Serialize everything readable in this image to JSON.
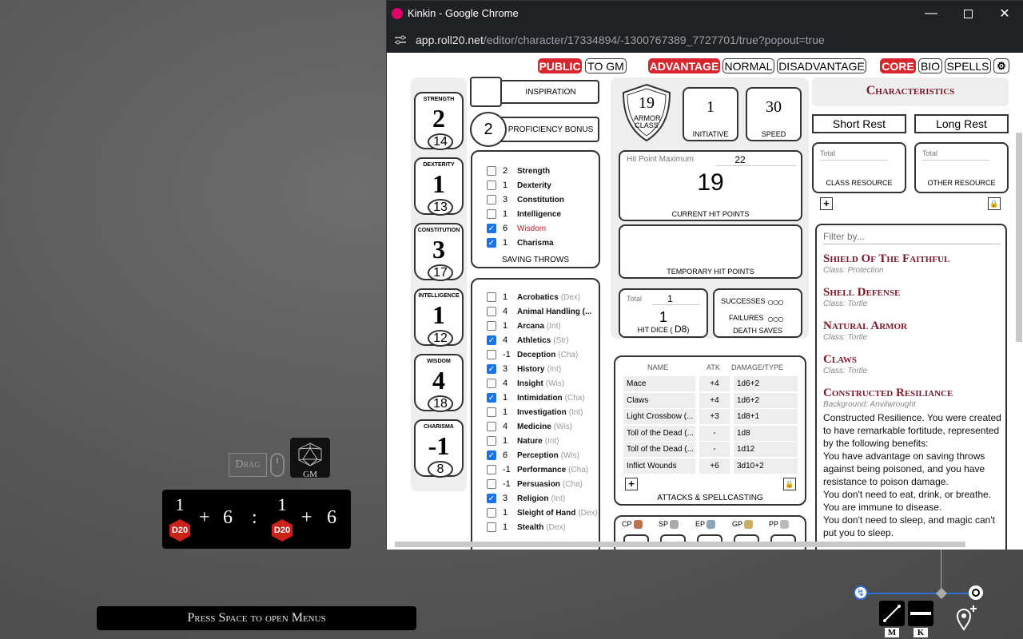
{
  "window": {
    "title": "Kinkin - Google Chrome",
    "url_host": "app.roll20.net",
    "url_path": "/editor/character/17334894/-1300767389_7727701/true?popout=true"
  },
  "toggles": {
    "public": "PUBLIC",
    "to_gm": "TO GM",
    "advantage": "ADVANTAGE",
    "normal": "NORMAL",
    "disadvantage": "DISADVANTAGE",
    "core": "CORE",
    "bio": "BIO",
    "spells": "SPELLS"
  },
  "abilities": [
    {
      "name": "STRENGTH",
      "mod": "2",
      "score": "14"
    },
    {
      "name": "DEXTERITY",
      "mod": "1",
      "score": "13"
    },
    {
      "name": "CONSTITUTION",
      "mod": "3",
      "score": "17"
    },
    {
      "name": "INTELLIGENCE",
      "mod": "1",
      "score": "12"
    },
    {
      "name": "WISDOM",
      "mod": "4",
      "score": "18"
    },
    {
      "name": "CHARISMA",
      "mod": "-1",
      "score": "8"
    }
  ],
  "inspiration": {
    "label": "INSPIRATION"
  },
  "proficiency": {
    "value": "2",
    "label": "PROFICIENCY BONUS"
  },
  "saving_throws": {
    "label": "SAVING THROWS",
    "items": [
      {
        "value": "2",
        "name": "Strength",
        "checked": false
      },
      {
        "value": "1",
        "name": "Dexterity",
        "checked": false
      },
      {
        "value": "3",
        "name": "Constitution",
        "checked": false
      },
      {
        "value": "1",
        "name": "Intelligence",
        "checked": false
      },
      {
        "value": "6",
        "name": "Wisdom",
        "checked": true
      },
      {
        "value": "1",
        "name": "Charisma",
        "checked": true
      }
    ]
  },
  "skills": [
    {
      "value": "1",
      "name": "Acrobatics",
      "ability": "(Dex)",
      "checked": false
    },
    {
      "value": "4",
      "name": "Animal Handling (...",
      "ability": "",
      "checked": false
    },
    {
      "value": "1",
      "name": "Arcana",
      "ability": "(Int)",
      "checked": false
    },
    {
      "value": "4",
      "name": "Athletics",
      "ability": "(Str)",
      "checked": true
    },
    {
      "value": "-1",
      "name": "Deception",
      "ability": "(Cha)",
      "checked": false
    },
    {
      "value": "3",
      "name": "History",
      "ability": "(Int)",
      "checked": true
    },
    {
      "value": "4",
      "name": "Insight",
      "ability": "(Wis)",
      "checked": false
    },
    {
      "value": "1",
      "name": "Intimidation",
      "ability": "(Cha)",
      "checked": true
    },
    {
      "value": "1",
      "name": "Investigation",
      "ability": "(Int)",
      "checked": false
    },
    {
      "value": "4",
      "name": "Medicine",
      "ability": "(Wis)",
      "checked": false
    },
    {
      "value": "1",
      "name": "Nature",
      "ability": "(Int)",
      "checked": false
    },
    {
      "value": "6",
      "name": "Perception",
      "ability": "(Wis)",
      "checked": true
    },
    {
      "value": "-1",
      "name": "Performance",
      "ability": "(Cha)",
      "checked": false
    },
    {
      "value": "-1",
      "name": "Persuasion",
      "ability": "(Cha)",
      "checked": false
    },
    {
      "value": "3",
      "name": "Religion",
      "ability": "(Int)",
      "checked": true
    },
    {
      "value": "1",
      "name": "Sleight of Hand",
      "ability": "(Dex)",
      "checked": false
    },
    {
      "value": "1",
      "name": "Stealth",
      "ability": "(Dex)",
      "checked": false
    }
  ],
  "combat": {
    "ac": "19",
    "ac_label": "ARMOR CLASS",
    "initiative": "1",
    "initiative_label": "INITIATIVE",
    "speed": "30",
    "speed_label": "SPEED",
    "hp_max_label": "Hit Point Maximum",
    "hp_max": "22",
    "hp_current": "19",
    "hp_current_label": "CURRENT HIT POINTS",
    "temp_label": "TEMPORARY HIT POINTS",
    "hd_total_label": "Total",
    "hd_total": "1",
    "hd_current": "1",
    "hd_label": "HIT DICE",
    "hd_die": "D8",
    "ds_success": "SUCCESSES",
    "ds_fail": "FAILURES",
    "ds_label": "DEATH SAVES"
  },
  "attacks": {
    "headers": {
      "name": "NAME",
      "atk": "ATK",
      "dmg": "DAMAGE/TYPE"
    },
    "rows": [
      {
        "name": "Mace",
        "atk": "+4",
        "dmg": "1d6+2"
      },
      {
        "name": "Claws",
        "atk": "+4",
        "dmg": "1d6+2"
      },
      {
        "name": "Light Crossbow (...",
        "atk": "+3",
        "dmg": "1d8+1"
      },
      {
        "name": "Toll of the Dead (...",
        "atk": "-",
        "dmg": "1d8"
      },
      {
        "name": "Toll of the Dead (...",
        "atk": "-",
        "dmg": "1d12"
      },
      {
        "name": "Inflict Wounds",
        "atk": "+6",
        "dmg": "3d10+2"
      }
    ],
    "label": "ATTACKS & SPELLCASTING"
  },
  "coins": [
    "CP",
    "SP",
    "EP",
    "GP",
    "PP"
  ],
  "right": {
    "characteristics": "Characteristics",
    "short_rest": "Short Rest",
    "long_rest": "Long Rest",
    "class_total_label": "Total",
    "class_resource": "CLASS RESOURCE",
    "other_total_label": "Total",
    "other_resource": "OTHER RESOURCE",
    "filter_placeholder": "Filter by...",
    "features": [
      {
        "title": "Shield Of The Faithful",
        "sub": "Class: Protection"
      },
      {
        "title": "Shell Defense",
        "sub": "Class: Tortle"
      },
      {
        "title": "Natural Armor",
        "sub": "Class: Tortle"
      },
      {
        "title": "Claws",
        "sub": "Class: Tortle"
      },
      {
        "title": "Constructed Resiliance",
        "sub": "Background: Anvilwrought"
      }
    ],
    "description": [
      "Constructed Resilience. You were created to have remarkable fortitude, represented by the following benefits:",
      "You have advantage on saving throws against being poisoned, and you have resistance to poison damage.",
      "You don't need to eat, drink, or breathe. You are immune to disease.",
      "You don't need to sleep, and magic can't put you to sleep."
    ]
  },
  "vtt": {
    "drag": "Drag",
    "gm": "GM",
    "roll": {
      "d1": "1",
      "mod1": "6",
      "d2": "1",
      "mod2": "6",
      "die_label": "D20",
      "plus": "+",
      "sep": ":"
    },
    "menu_hint": "Press Space to open Menus",
    "key_m": "M",
    "key_k": "K"
  }
}
